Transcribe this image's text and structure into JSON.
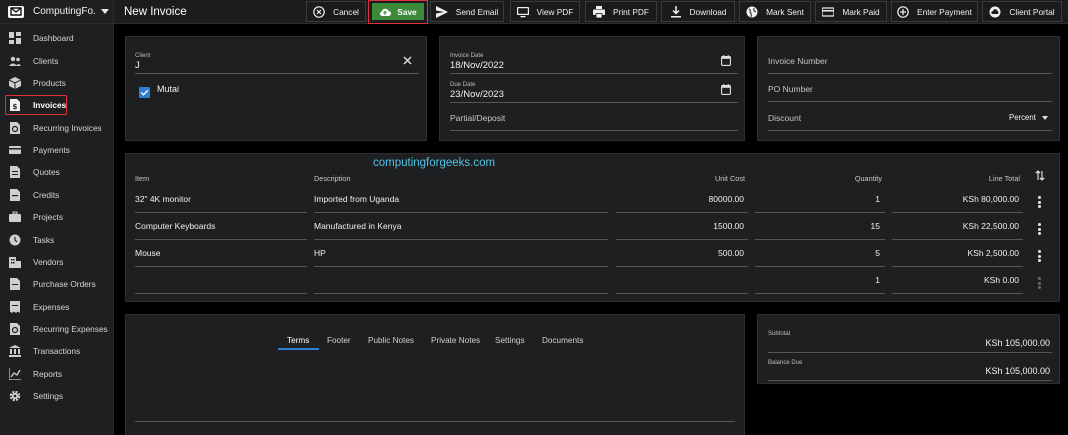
{
  "sidebar": {
    "brand": "ComputingFo...",
    "items": [
      {
        "label": "Dashboard",
        "icon": "dashboard-icon"
      },
      {
        "label": "Clients",
        "icon": "clients-icon"
      },
      {
        "label": "Products",
        "icon": "products-icon"
      },
      {
        "label": "Invoices",
        "icon": "invoices-icon",
        "active": true
      },
      {
        "label": "Recurring Invoices",
        "icon": "recurring-invoices-icon"
      },
      {
        "label": "Payments",
        "icon": "payments-icon"
      },
      {
        "label": "Quotes",
        "icon": "quotes-icon"
      },
      {
        "label": "Credits",
        "icon": "credits-icon"
      },
      {
        "label": "Projects",
        "icon": "projects-icon"
      },
      {
        "label": "Tasks",
        "icon": "tasks-icon"
      },
      {
        "label": "Vendors",
        "icon": "vendors-icon"
      },
      {
        "label": "Purchase Orders",
        "icon": "purchase-orders-icon"
      },
      {
        "label": "Expenses",
        "icon": "expenses-icon"
      },
      {
        "label": "Recurring Expenses",
        "icon": "recurring-expenses-icon"
      },
      {
        "label": "Transactions",
        "icon": "transactions-icon"
      },
      {
        "label": "Reports",
        "icon": "reports-icon"
      },
      {
        "label": "Settings",
        "icon": "settings-icon"
      }
    ]
  },
  "header": {
    "title": "New Invoice",
    "actions": {
      "cancel": "Cancel",
      "save": "Save",
      "send_email": "Send Email",
      "view_pdf": "View PDF",
      "print_pdf": "Print PDF",
      "download": "Download",
      "mark_sent": "Mark Sent",
      "mark_paid": "Mark Paid",
      "enter_payment": "Enter Payment",
      "client_portal": "Client Portal"
    }
  },
  "client": {
    "label": "Client",
    "value": "J",
    "contact_name": "Mutai",
    "contact_checked": true
  },
  "dates": {
    "invoice_date_label": "Invoice Date",
    "invoice_date": "18/Nov/2022",
    "due_date_label": "Due Date",
    "due_date": "23/Nov/2023",
    "partial_placeholder": "Partial/Deposit"
  },
  "meta": {
    "invoice_number_placeholder": "Invoice Number",
    "po_number_placeholder": "PO Number",
    "discount_placeholder": "Discount",
    "discount_type": "Percent"
  },
  "watermark": "computingforgeeks.com",
  "items": {
    "columns": {
      "item": "Item",
      "description": "Description",
      "unit_cost": "Unit Cost",
      "quantity": "Quantity",
      "line_total": "Line Total"
    },
    "rows": [
      {
        "item": "32\" 4K monitor",
        "description": "Imported from Uganda",
        "unit_cost": "80000.00",
        "quantity": "1",
        "line_total": "KSh 80,000.00"
      },
      {
        "item": "Computer Keyboards",
        "description": "Manufactured in Kenya",
        "unit_cost": "1500.00",
        "quantity": "15",
        "line_total": "KSh 22,500.00"
      },
      {
        "item": "Mouse",
        "description": "HP",
        "unit_cost": "500.00",
        "quantity": "5",
        "line_total": "KSh 2,500.00"
      },
      {
        "item": "",
        "description": "",
        "unit_cost": "",
        "quantity": "1",
        "line_total": "KSh 0.00"
      }
    ]
  },
  "tabs": [
    "Terms",
    "Footer",
    "Public Notes",
    "Private Notes",
    "Settings",
    "Documents"
  ],
  "totals": {
    "subtotal_label": "Subtotal",
    "subtotal": "KSh 105,000.00",
    "balance_due_label": "Balance Due",
    "balance_due": "KSh 105,000.00"
  },
  "colors": {
    "accent": "#2f7fd0",
    "save_green": "#3d8a3a",
    "highlight_red": "#e0303a",
    "watermark": "#4fc3e8"
  }
}
